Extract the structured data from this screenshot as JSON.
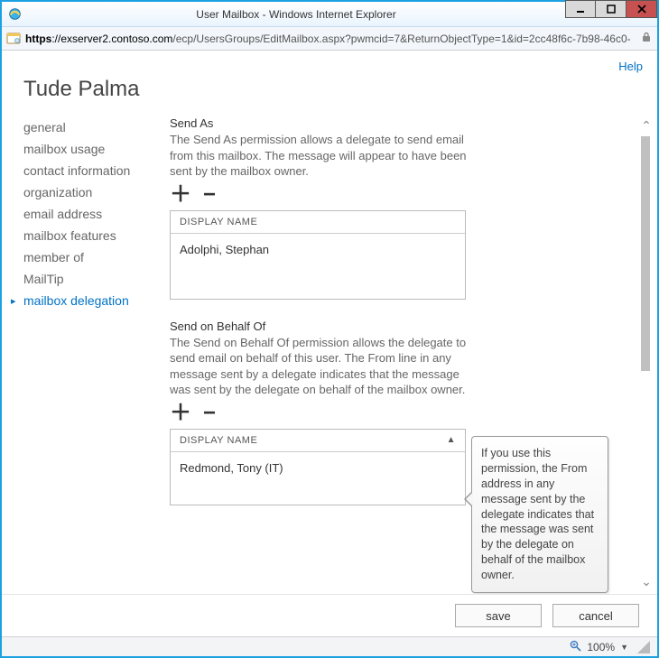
{
  "window": {
    "title": "User Mailbox - Windows Internet Explorer"
  },
  "address": {
    "scheme": "https",
    "host": "://exserver2.contoso.com",
    "path": "/ecp/UsersGroups/EditMailbox.aspx?pwmcid=7&ReturnObjectType=1&id=2cc48f6c-7b98-46c0-"
  },
  "help_label": "Help",
  "page_title": "Tude Palma",
  "sidebar": {
    "items": [
      {
        "label": "general"
      },
      {
        "label": "mailbox usage"
      },
      {
        "label": "contact information"
      },
      {
        "label": "organization"
      },
      {
        "label": "email address"
      },
      {
        "label": "mailbox features"
      },
      {
        "label": "member of"
      },
      {
        "label": "MailTip"
      },
      {
        "label": "mailbox delegation"
      }
    ],
    "active_index": 8
  },
  "sections": {
    "send_as": {
      "title": "Send As",
      "desc": "The Send As permission allows a delegate to send email from this mailbox. The message will appear to have been sent by the mailbox owner.",
      "column": "DISPLAY NAME",
      "rows": [
        "Adolphi, Stephan"
      ]
    },
    "send_on_behalf": {
      "title": "Send on Behalf Of",
      "desc": "The Send on Behalf Of permission allows the delegate to send email on behalf of this user. The From line in any message sent by a delegate indicates that the message was sent by the delegate on behalf of the mailbox owner.",
      "column": "DISPLAY NAME",
      "rows": [
        "Redmond, Tony (IT)"
      ],
      "sort_indicator": "▲"
    }
  },
  "callout": "If you use this permission, the From address in any message sent by the delegate indicates that the message was sent by the delegate on behalf of the mailbox owner.",
  "buttons": {
    "save": "save",
    "cancel": "cancel"
  },
  "status": {
    "zoom": "100%"
  },
  "glyphs": {
    "plus": "＋",
    "minus": "−"
  }
}
